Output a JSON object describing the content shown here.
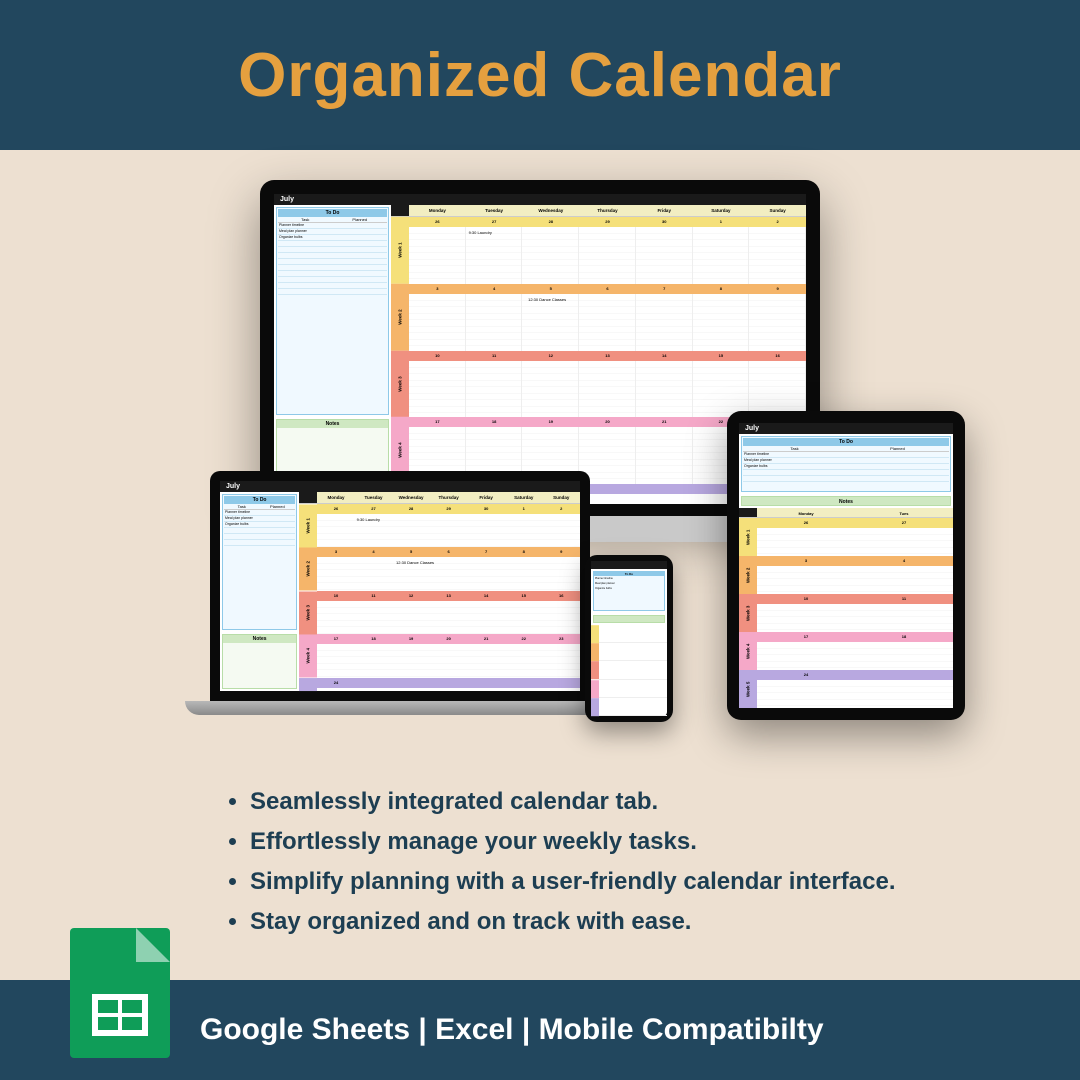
{
  "header": {
    "title": "Organized Calendar"
  },
  "calendar": {
    "month": "July",
    "todo_header": "To Do",
    "task_label": "Task",
    "planned_label": "Planned",
    "notes_label": "Notes",
    "tasks": [
      "Planner timeline",
      "Meal plan planner",
      "Organize bulbs"
    ],
    "days": [
      "Monday",
      "Tuesday",
      "Wednesday",
      "Thursday",
      "Friday",
      "Saturday",
      "Sunday"
    ],
    "weeks": {
      "w1": {
        "label": "Week 1",
        "dates": [
          "26",
          "27",
          "28",
          "29",
          "30",
          "1",
          "2"
        ],
        "event": "9:30 Laundry"
      },
      "w2": {
        "label": "Week 2",
        "dates": [
          "3",
          "4",
          "5",
          "6",
          "7",
          "8",
          "9"
        ],
        "event": "12:30 Dance Classes"
      },
      "w3": {
        "label": "Week 3",
        "dates": [
          "10",
          "11",
          "12",
          "13",
          "14",
          "15",
          "16"
        ]
      },
      "w4": {
        "label": "Week 4",
        "dates": [
          "17",
          "18",
          "19",
          "20",
          "21",
          "22",
          "23"
        ]
      },
      "w5": {
        "label": "Week 5",
        "dates": [
          "24",
          "",
          "",
          "",
          "",
          "",
          ""
        ]
      }
    },
    "tablet_days": [
      "Monday",
      "Tues"
    ]
  },
  "bullets": [
    "Seamlessly integrated calendar tab.",
    "Effortlessly manage your weekly tasks.",
    "Simplify planning with a user-friendly calendar interface.",
    "Stay organized and on track with ease."
  ],
  "footer": {
    "text": "Google Sheets | Excel | Mobile Compatibilty"
  }
}
